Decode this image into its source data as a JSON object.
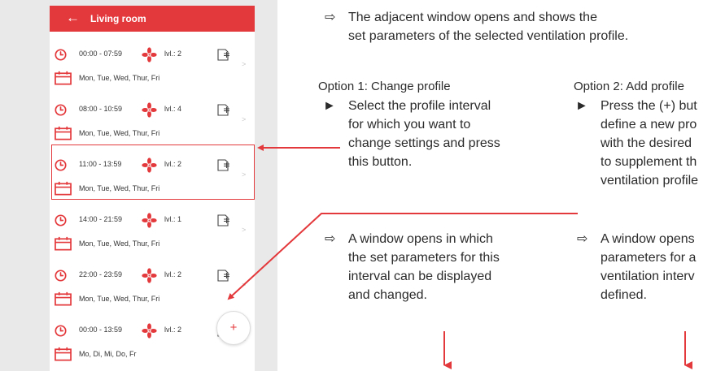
{
  "app": {
    "title": "Living room",
    "back_icon": "back-arrow-icon",
    "accent_color": "#e4393c"
  },
  "profiles": [
    {
      "time": "00:00 - 07:59",
      "level": "lvl.: 2",
      "days": "Mon, Tue, Wed, Thur, Fri"
    },
    {
      "time": "08:00 - 10:59",
      "level": "lvl.: 4",
      "days": "Mon, Tue, Wed, Thur, Fri"
    },
    {
      "time": "11:00 - 13:59",
      "level": "lvl.: 2",
      "days": "Mon, Tue, Wed, Thur, Fri",
      "selected": true
    },
    {
      "time": "14:00 - 21:59",
      "level": "lvl.: 1",
      "days": "Mon, Tue, Wed, Thur, Fri"
    },
    {
      "time": "22:00 - 23:59",
      "level": "lvl.: 2",
      "days": "Mon, Tue, Wed, Thur, Fri"
    },
    {
      "time": "00:00 - 13:59",
      "level": "lvl.: 2",
      "days": "Mo, Di, Mi, Do, Fr"
    }
  ],
  "add_button": {
    "label": "+"
  },
  "doc": {
    "intro_marker": "⇨",
    "intro_line1": "The adjacent window opens and shows the",
    "intro_line2": "set parameters of the selected ventilation profile.",
    "option1": {
      "heading": "Option 1: Change profile",
      "bullet": "►",
      "lines": [
        "Select the profile interval",
        "for which you want to",
        "change settings and press",
        "this button."
      ],
      "result_marker": "⇨",
      "result_lines": [
        "A window opens in which",
        "the set parameters for this",
        "interval can be displayed",
        "and changed."
      ]
    },
    "option2": {
      "heading": "Option 2: Add profile",
      "bullet": "►",
      "lines": [
        "Press the (+) but",
        "define a new pro",
        "with the desired",
        "to supplement th",
        "ventilation profile"
      ],
      "result_marker": "⇨",
      "result_lines": [
        "A window opens",
        "parameters for a",
        "ventilation interv",
        "defined."
      ]
    }
  }
}
